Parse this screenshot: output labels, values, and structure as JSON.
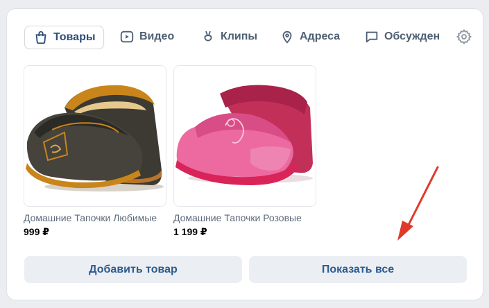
{
  "tabs": [
    {
      "label": "Товары",
      "icon": "bag-icon",
      "active": true
    },
    {
      "label": "Видео",
      "icon": "video-icon",
      "active": false
    },
    {
      "label": "Клипы",
      "icon": "clips-icon",
      "active": false
    },
    {
      "label": "Адреса",
      "icon": "location-pin-icon",
      "active": false
    },
    {
      "label": "Обсужден",
      "icon": "chat-bubble-icon",
      "active": false
    }
  ],
  "settings_icon": "gear-icon",
  "products": [
    {
      "title": "Домашние Тапочки Любимые",
      "price": "999 ₽",
      "image": "dark-slippers-image"
    },
    {
      "title": "Домашние Тапочки Розовые",
      "price": "1 199 ₽",
      "image": "pink-slippers-image"
    }
  ],
  "actions": {
    "add_label": "Добавить товар",
    "show_all_label": "Показать все"
  },
  "colors": {
    "accent": "#2d5b8f",
    "annotation_arrow": "#e0392b"
  }
}
